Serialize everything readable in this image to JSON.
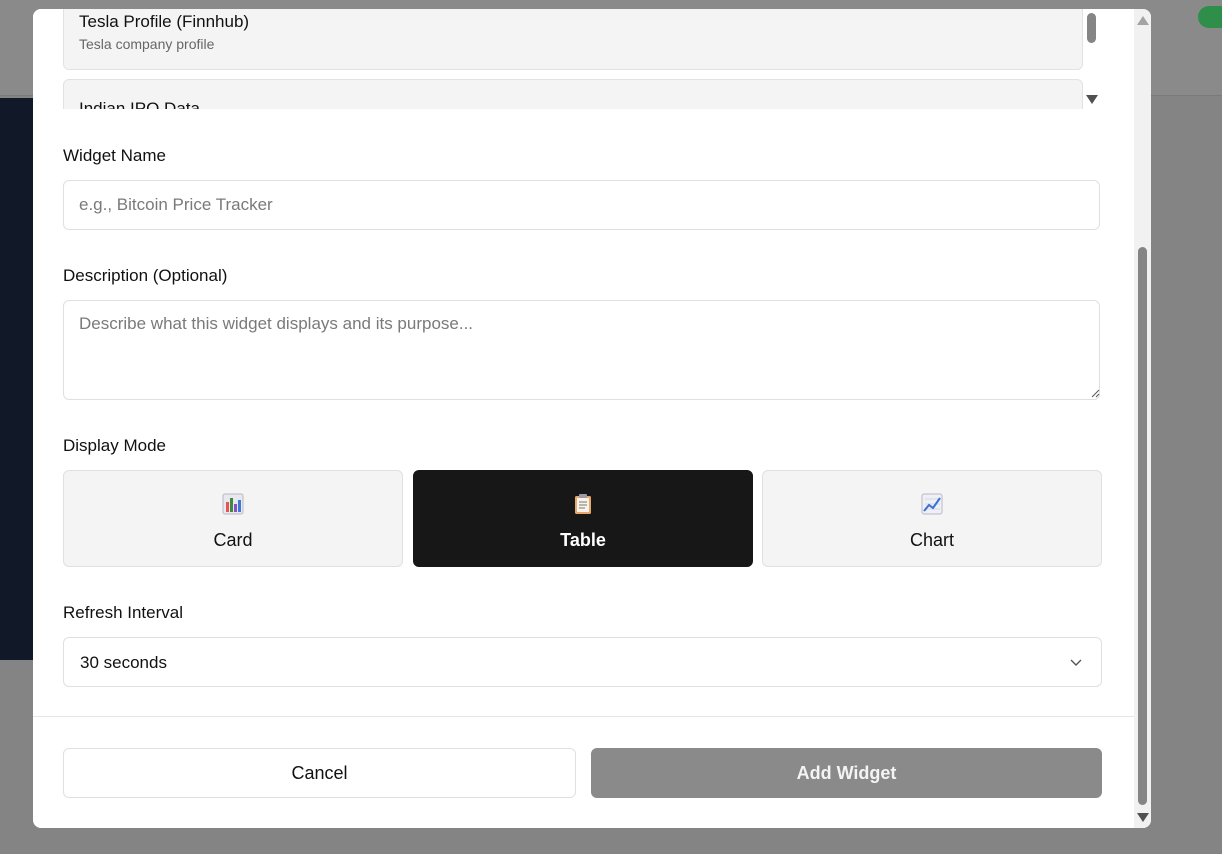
{
  "source_list": {
    "items": [
      {
        "name": "Tesla Profile (Finnhub)",
        "description": "Tesla company profile"
      },
      {
        "name": "Indian IPO Data",
        "description": ""
      }
    ]
  },
  "form": {
    "widget_name": {
      "label": "Widget Name",
      "placeholder": "e.g., Bitcoin Price Tracker",
      "value": ""
    },
    "description": {
      "label": "Description (Optional)",
      "placeholder": "Describe what this widget displays and its purpose...",
      "value": ""
    },
    "display_mode": {
      "label": "Display Mode",
      "options": [
        {
          "label": "Card",
          "icon": "bar-chart-icon"
        },
        {
          "label": "Table",
          "icon": "clipboard-icon"
        },
        {
          "label": "Chart",
          "icon": "line-chart-icon"
        }
      ],
      "selected": "Table"
    },
    "refresh_interval": {
      "label": "Refresh Interval",
      "value": "30 seconds"
    }
  },
  "footer": {
    "cancel_label": "Cancel",
    "add_label": "Add Widget"
  },
  "colors": {
    "active_mode_bg": "#171717",
    "add_button_bg": "#8a8a8a",
    "field_border": "#e0e0e0",
    "option_bg": "#f4f4f4"
  }
}
